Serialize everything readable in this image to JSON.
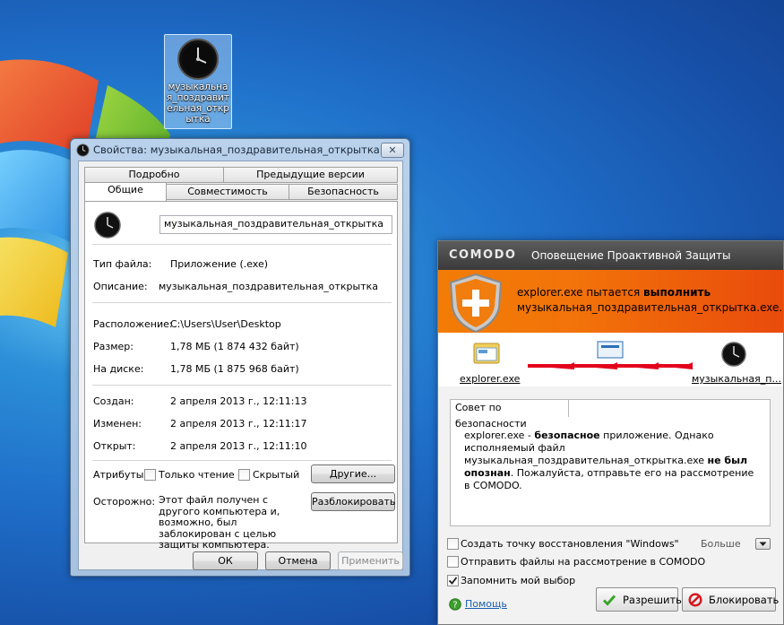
{
  "desktop": {
    "icon_label": "музыкальна я_поздравит ельная_откр ытка",
    "colors": {
      "wallpaper": "#1f6fc9"
    }
  },
  "properties": {
    "title": "Свойства: музыкальная_поздравительная_открытка",
    "tabs_row1": [
      "Подробно",
      "Предыдущие версии"
    ],
    "tabs_row2": [
      "Общие",
      "Совместимость",
      "Безопасность"
    ],
    "file_name": "музыкальная_поздравительная_открытка",
    "rows": {
      "type_label": "Тип файла:",
      "type_value": "Приложение (.exe)",
      "desc_label": "Описание:",
      "desc_value": "музыкальная_поздравительная_открытка",
      "location_label": "Расположение:",
      "location_value": "C:\\Users\\User\\Desktop",
      "size_label": "Размер:",
      "size_value": "1,78 МБ (1 874 432 байт)",
      "disk_label": "На диске:",
      "disk_value": "1,78 МБ (1 875 968 байт)",
      "created_label": "Создан:",
      "created_value": "2 апреля 2013 г., 12:11:13",
      "modified_label": "Изменен:",
      "modified_value": "2 апреля 2013 г., 12:11:17",
      "opened_label": "Открыт:",
      "opened_value": "2 апреля 2013 г., 12:11:10"
    },
    "attributes_label": "Атрибуты:",
    "readonly_label": "Только чтение",
    "hidden_label": "Скрытый",
    "other_button": "Другие...",
    "caution_label": "Осторожно:",
    "caution_text": "Этот файл получен с другого компьютера и, возможно, был заблокирован с целью защиты компьютера.",
    "unblock_button": "Разблокировать",
    "ok_button": "ОК",
    "cancel_button": "Отмена",
    "apply_button": "Применить"
  },
  "comodo": {
    "logo": "COMODO",
    "title": "Оповещение Проактивной Защиты",
    "alert_prefix": "explorer.exe пытается ",
    "alert_action": "выполнить",
    "alert_target": "музыкальная_поздравительная_открытка.exe.",
    "source_label": "explorer.exe",
    "target_label": "музыкальная_п...",
    "advice_tab": "Совет по безопасности",
    "advice": {
      "p1": "explorer.exe - ",
      "b1": "безопасное",
      "p2": " приложение. Однако исполняемый файл музыкальная_поздравительная_открытка.exe ",
      "b2": "не был опознан",
      "p3": ". Пожалуйста, отправьте его на рассмотрение в COMODO."
    },
    "restore_point_label": "Создать точку восстановления \"Windows\"",
    "more_label": "Больше",
    "submit_label": "Отправить файлы на рассмотрение в COMODO",
    "remember_label": "Запомнить мой выбор",
    "remember_checked": true,
    "help_label": "Помощь",
    "allow_button": "Разрешить",
    "block_button": "Блокировать",
    "colors": {
      "banner": "#f27c05",
      "accent_red": "#e3001b",
      "titlebar": "#4a4a4a"
    }
  }
}
